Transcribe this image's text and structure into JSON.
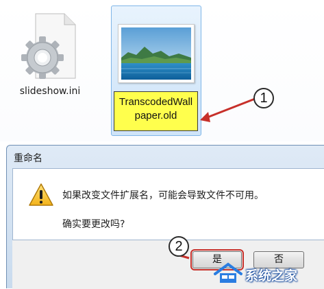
{
  "explorer": {
    "files": [
      {
        "name": "slideshow.ini",
        "icon": "settings-file-icon"
      },
      {
        "name_line1": "TranscodedWall",
        "name_line2": "paper.old",
        "icon": "image-file-icon",
        "selected": true,
        "editing": true
      }
    ]
  },
  "callouts": {
    "step1": "1",
    "step2": "2"
  },
  "dialog": {
    "title": "重命名",
    "icon": "warning-icon",
    "message": "如果改变文件扩展名，可能会导致文件不可用。",
    "question": "确实要更改吗?",
    "yes_label": "是",
    "no_label": "否"
  },
  "watermark": {
    "text": "系统之家"
  },
  "colors": {
    "selection_bg": "#d7e9fa",
    "rename_highlight": "#ffff4d",
    "arrow_red": "#c7302a",
    "dialog_frame": "#c9dbee"
  }
}
